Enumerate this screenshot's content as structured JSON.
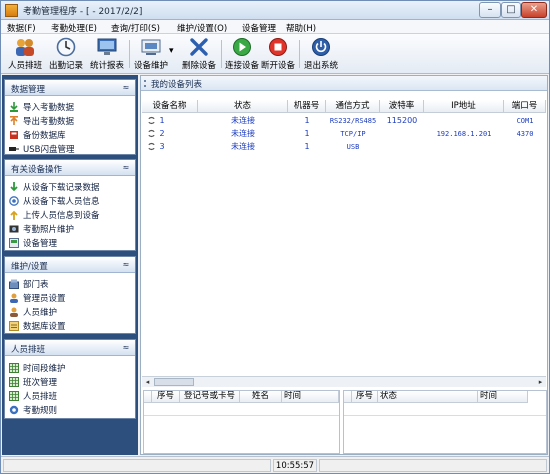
{
  "window": {
    "title": "考勤管理程序 - [ - 2017/2/2]",
    "min": "–",
    "max": "□",
    "close": "✕"
  },
  "menu": [
    "数据(F)",
    "考勤处理(E)",
    "查询/打印(S)",
    "维护/设置(O)",
    "设备管理",
    "帮助(H)"
  ],
  "toolbar": {
    "staff": "人员排班",
    "attendance": "出勤记录",
    "report": "统计报表",
    "device_maint": "设备维护",
    "delete_device": "删除设备",
    "connect": "连接设备",
    "disconnect": "断开设备",
    "exit": "退出系统",
    "dropdown": "▾"
  },
  "sidebar": {
    "sections": [
      {
        "title": "数据管理",
        "items": [
          "导入考勤数据",
          "导出考勤数据",
          "备份数据库",
          "USB闪盘管理"
        ]
      },
      {
        "title": "有关设备操作",
        "items": [
          "从设备下载记录数据",
          "从设备下载人员信息",
          "上传人员信息到设备",
          "考勤照片维护",
          "设备管理"
        ]
      },
      {
        "title": "维护/设置",
        "items": [
          "部门表",
          "管理员设置",
          "人员维护",
          "数据库设置"
        ]
      },
      {
        "title": "人员排班",
        "items": [
          "时间段维护",
          "班次管理",
          "人员排班",
          "考勤规则"
        ]
      }
    ],
    "collapse": "≈"
  },
  "device_list": {
    "title": "我的设备列表",
    "columns": [
      "设备名称",
      "状态",
      "机器号",
      "通信方式",
      "波特率",
      "IP地址",
      "端口号"
    ],
    "rows": [
      {
        "name": "1",
        "status": "未连接",
        "machine": "1",
        "comm": "RS232/RS485",
        "baud": "115200",
        "ip": "",
        "port": "COM1"
      },
      {
        "name": "2",
        "status": "未连接",
        "machine": "1",
        "comm": "TCP/IP",
        "baud": "",
        "ip": "192.168.1.201",
        "port": "4370"
      },
      {
        "name": "3",
        "status": "未连接",
        "machine": "1",
        "comm": "USB",
        "baud": "",
        "ip": "",
        "port": ""
      }
    ]
  },
  "record_grid": {
    "columns": [
      "序号",
      "登记号或卡号",
      "姓名",
      "时间"
    ]
  },
  "status_grid": {
    "columns": [
      "序号",
      "状态",
      "时间"
    ]
  },
  "scroll": {
    "left": "◂",
    "right": "▸"
  },
  "statusbar": {
    "time": "10:55:57"
  }
}
